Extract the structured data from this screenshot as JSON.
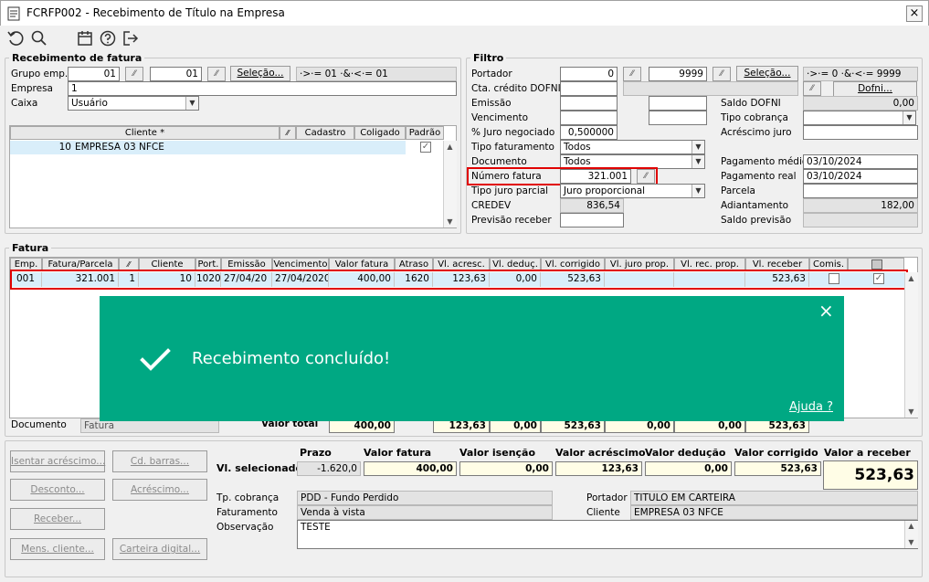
{
  "window": {
    "title": "FCRFP002 - Recebimento de Título na Empresa",
    "close": "×"
  },
  "receb": {
    "title": "Recebimento de fatura",
    "grupo_label": "Grupo emp.",
    "grupo_de": "01",
    "grupo_ate": "01",
    "selecao_btn": "Seleção...",
    "grupo_range": "·>·= 01 ·&·<·= 01",
    "empresa_label": "Empresa",
    "empresa_value": "1",
    "caixa_label": "Caixa",
    "caixa_value": "Usuário",
    "grid_headers": [
      "Cliente *",
      "Cadastro",
      "Coligado",
      "Padrão"
    ],
    "grid_row": {
      "codigo": "10",
      "nome": "EMPRESA 03 NFCE"
    }
  },
  "filtro": {
    "title": "Filtro",
    "portador_label": "Portador",
    "portador_de": "0",
    "portador_ate": "9999",
    "selecao_btn": "Seleção...",
    "portador_range": "·>·= 0 ·&·<·= 9999",
    "cta_label": "Cta. crédito DOFNI",
    "dofni_btn": "Dofni...",
    "emissao_label": "Emissão",
    "vencimento_label": "Vencimento",
    "juro_label": "% Juro negociado",
    "juro_value": "0,500000",
    "tipo_fat_label": "Tipo faturamento",
    "tipo_fat_value": "Todos",
    "documento_label": "Documento",
    "documento_value": "Todos",
    "numero_label": "Número fatura",
    "numero_value": "321.001",
    "tipo_juro_label": "Tipo juro parcial",
    "tipo_juro_value": "Juro proporcional",
    "credev_label": "CREDEV",
    "credev_value": "836,54",
    "previsao_label": "Previsão receber",
    "saldo_dofni_label": "Saldo DOFNI",
    "saldo_dofni_value": "0,00",
    "tipo_cob_label": "Tipo cobrança",
    "acresc_juro_label": "Acréscimo juro",
    "pag_medio_label": "Pagamento médio",
    "pag_medio_value": "03/10/2024",
    "pag_real_label": "Pagamento real",
    "pag_real_value": "03/10/2024",
    "parcela_label": "Parcela",
    "adiantamento_label": "Adiantamento",
    "adiantamento_value": "182,00",
    "saldo_prev_label": "Saldo previsão"
  },
  "fatura": {
    "title": "Fatura",
    "headers": [
      "Emp.",
      "Fatura/Parcela",
      "",
      "Cliente",
      "Port.",
      "Emissão",
      "Vencimento",
      "Valor fatura",
      "Atraso",
      "Vl. acresc.",
      "Vl. deduç.",
      "Vl. corrigido",
      "Vl. juro prop.",
      "Vl. rec. prop.",
      "Vl. receber",
      "Comis.",
      ""
    ],
    "row": [
      "001",
      "321.001",
      "1",
      "10",
      "1020",
      "27/04/20",
      "27/04/2020",
      "400,00",
      "1620",
      "123,63",
      "0,00",
      "523,63",
      "",
      "",
      "523,63"
    ],
    "documento_label": "Documento",
    "documento_value": "Fatura",
    "total_label": "Valor total",
    "totals": [
      "400,00",
      "123,63",
      "0,00",
      "523,63",
      "0,00",
      "0,00",
      "523,63"
    ]
  },
  "buttons": {
    "isentar": "Isentar acréscimo...",
    "cd_barras": "Cd. barras...",
    "desconto": "Desconto...",
    "acrescimo": "Acréscimo...",
    "receber": "Receber...",
    "mens_cliente": "Mens. cliente...",
    "carteira": "Carteira digital..."
  },
  "summary": {
    "prazo_h": "Prazo",
    "valor_fatura_h": "Valor fatura",
    "valor_isencao_h": "Valor isenção",
    "valor_acrescimo_h": "Valor acréscimo",
    "valor_deducao_h": "Valor dedução",
    "valor_corrigido_h": "Valor corrigido",
    "valor_receber_h": "Valor a receber",
    "row_label": "Vl. selecionado",
    "prazo": "-1.620,0",
    "valor_fatura": "400,00",
    "valor_isencao": "0,00",
    "valor_acrescimo": "123,63",
    "valor_deducao": "0,00",
    "valor_corrigido": "523,63",
    "valor_receber": "523,63"
  },
  "info": {
    "tp_cob_label": "Tp. cobrança",
    "tp_cob_value": "PDD - Fundo Perdido",
    "faturamento_label": "Faturamento",
    "faturamento_value": "Venda à vista",
    "observacao_label": "Observação",
    "observacao_value": "TESTE",
    "portador_label": "Portador",
    "portador_value": "TITULO EM CARTEIRA",
    "cliente_label": "Cliente",
    "cliente_value": "EMPRESA 03 NFCE"
  },
  "toast": {
    "message": "Recebimento concluído!",
    "help": "Ajuda ?",
    "close": "×",
    "color": "#00a883"
  },
  "colors": {
    "highlight": "#e00000",
    "selected_row": "#d9eefa"
  }
}
